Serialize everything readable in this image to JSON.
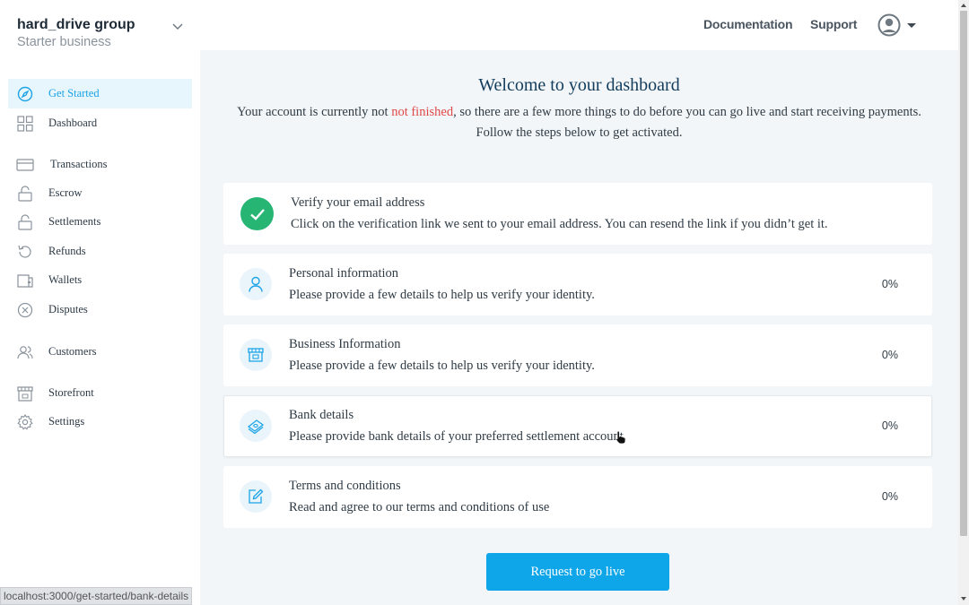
{
  "org": {
    "name": "hard_drive group",
    "plan": "Starter business"
  },
  "sidebar": {
    "items": [
      {
        "label": "Get Started",
        "icon": "compass-icon",
        "active": true
      },
      {
        "label": "Dashboard",
        "icon": "grid-icon"
      },
      {
        "label": "Transactions",
        "icon": "card-icon"
      },
      {
        "label": "Escrow",
        "icon": "unlock-icon"
      },
      {
        "label": "Settlements",
        "icon": "unlock-icon"
      },
      {
        "label": "Refunds",
        "icon": "refund-icon"
      },
      {
        "label": "Wallets",
        "icon": "wallet-icon"
      },
      {
        "label": "Disputes",
        "icon": "x-circle-icon"
      },
      {
        "label": "Customers",
        "icon": "users-icon"
      },
      {
        "label": "Storefront",
        "icon": "store-icon"
      },
      {
        "label": "Settings",
        "icon": "gear-icon"
      }
    ]
  },
  "header": {
    "documentation": "Documentation",
    "support": "Support"
  },
  "main": {
    "welcome": "Welcome to your dashboard",
    "intro_before": "Your account is currently not ",
    "intro_warn": "not finished",
    "intro_after": ", so there are a few more things to do before you can go live and start receiving payments.",
    "intro_line2": "Follow the steps below to get activated.",
    "steps": [
      {
        "title": "Verify your email address",
        "desc": "Click on the verification link we sent to your email address. You can resend the link if you didn’t get it.",
        "icon": "check-icon",
        "done": true
      },
      {
        "title": "Personal information",
        "desc": "Please provide a few details to help us verify your identity.",
        "percent": "0%",
        "icon": "user-icon"
      },
      {
        "title": "Business Information",
        "desc": "Please provide a few details to help us verify your identity.",
        "percent": "0%",
        "icon": "store-icon"
      },
      {
        "title": "Bank details",
        "desc": "Please provide bank details of your preferred settlement account.",
        "percent": "0%",
        "icon": "money-icon"
      },
      {
        "title": "Terms and conditions",
        "desc": "Read and agree to our terms and conditions of use",
        "percent": "0%",
        "icon": "edit-icon"
      }
    ],
    "go_live": "Request to go live"
  },
  "status_url": "localhost:3000/get-started/bank-details",
  "colors": {
    "accent": "#0ea5e9",
    "success": "#27b574",
    "warning": "#e04848",
    "active_bg": "#e7f5fc"
  }
}
